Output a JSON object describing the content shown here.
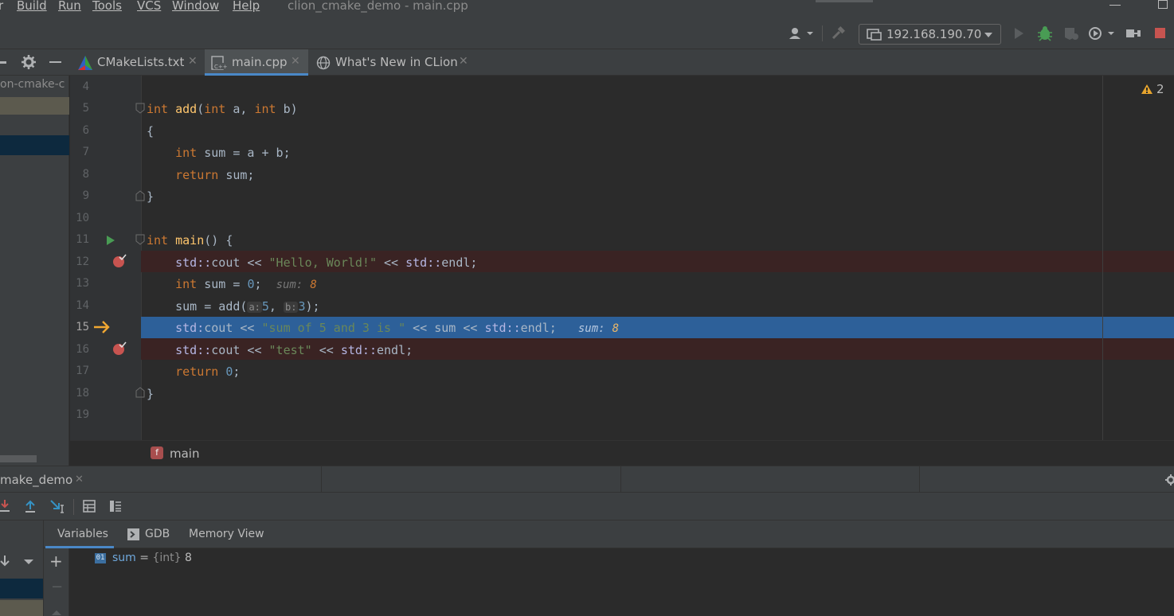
{
  "menu": {
    "items": [
      "r",
      "Build",
      "Run",
      "Tools",
      "VCS",
      "Window",
      "Help"
    ],
    "window_title": "clion_cmake_demo - main.cpp"
  },
  "toolbar": {
    "run_config": "192.168.190.70",
    "icons": [
      "user-icon",
      "build-hammer-icon",
      "remote-host-icon",
      "run-icon",
      "debug-icon",
      "coverage-icon",
      "profile-icon",
      "attach-icon",
      "stop-icon"
    ]
  },
  "tabs": [
    {
      "label": "CMakeLists.txt",
      "icon": "cmake-icon"
    },
    {
      "label": "main.cpp",
      "icon": "cpp-file-icon",
      "active": true
    },
    {
      "label": "What's New in CLion",
      "icon": "globe-icon"
    }
  ],
  "project": {
    "root_label": "on-cmake-c"
  },
  "editor": {
    "warning_count": "2",
    "lines": [
      {
        "n": "4"
      },
      {
        "n": "5",
        "tokens": [
          [
            "kw",
            "int "
          ],
          [
            "fn",
            "add"
          ],
          [
            "p",
            "("
          ],
          [
            "kw",
            "int "
          ],
          [
            "p",
            "a, "
          ],
          [
            "kw",
            "int "
          ],
          [
            "p",
            "b)"
          ]
        ]
      },
      {
        "n": "6",
        "tokens": [
          [
            "p",
            "{"
          ]
        ]
      },
      {
        "n": "7",
        "tokens": [
          [
            "p",
            "    "
          ],
          [
            "kw",
            "int "
          ],
          [
            "p",
            "sum = a + b;"
          ]
        ]
      },
      {
        "n": "8",
        "tokens": [
          [
            "p",
            "    "
          ],
          [
            "kw",
            "return "
          ],
          [
            "p",
            "sum;"
          ]
        ]
      },
      {
        "n": "9",
        "tokens": [
          [
            "p",
            "}"
          ]
        ]
      },
      {
        "n": "10"
      },
      {
        "n": "11",
        "tokens": [
          [
            "kw",
            "int "
          ],
          [
            "fn",
            "main"
          ],
          [
            "p",
            "() {"
          ]
        ]
      },
      {
        "n": "12",
        "tokens": [
          [
            "p",
            "    "
          ],
          [
            "ns",
            "std::"
          ],
          [
            "p",
            "cout << "
          ],
          [
            "str",
            "\"Hello, World!\""
          ],
          [
            "p",
            " << "
          ],
          [
            "ns",
            "std::"
          ],
          [
            "p",
            "endl;"
          ]
        ]
      },
      {
        "n": "13",
        "tokens": [
          [
            "p",
            "    "
          ],
          [
            "kw",
            "int "
          ],
          [
            "p",
            "sum = "
          ],
          [
            "num",
            "0"
          ],
          [
            "p",
            ";  "
          ]
        ]
      },
      {
        "n": "14",
        "tokens": [
          [
            "p",
            "    sum = add("
          ]
        ]
      },
      {
        "n": "15",
        "tokens": [
          [
            "p",
            "    "
          ],
          [
            "ns",
            "std:"
          ],
          [
            "p",
            "cout << "
          ],
          [
            "str",
            "\"sum of 5 and 3 is \""
          ],
          [
            "p",
            " << sum << "
          ],
          [
            "ns",
            "std::"
          ],
          [
            "p",
            "endl;"
          ]
        ]
      },
      {
        "n": "16",
        "tokens": [
          [
            "p",
            "    "
          ],
          [
            "ns",
            "std::"
          ],
          [
            "p",
            "cout << "
          ],
          [
            "str",
            "\"test\""
          ],
          [
            "p",
            " << "
          ],
          [
            "ns",
            "std::"
          ],
          [
            "p",
            "endl;"
          ]
        ]
      },
      {
        "n": "17",
        "tokens": [
          [
            "p",
            "    "
          ],
          [
            "kw",
            "return "
          ],
          [
            "num",
            "0"
          ],
          [
            "p",
            ";"
          ]
        ]
      },
      {
        "n": "18",
        "tokens": [
          [
            "p",
            "}"
          ]
        ]
      },
      {
        "n": "19"
      }
    ],
    "inline_values": {
      "line13_name": "sum:",
      "line13_value": "8",
      "line15_name": "sum:",
      "line15_value": "8"
    },
    "param_hints": {
      "a_label": "a:",
      "a_value": "5",
      "b_label": "b:",
      "b_value": "3",
      "tail": ");"
    },
    "current_line": "15",
    "breakpoint_lines": [
      "12",
      "16"
    ],
    "run_gutter_line": "11"
  },
  "breadcrumb": {
    "icon_letter": "f",
    "label": "main"
  },
  "debug": {
    "session_tab": "make_demo",
    "tabs": [
      "Variables",
      "GDB",
      "Memory View"
    ],
    "active_tab": "Variables",
    "variable": {
      "name": "sum",
      "eq": " = ",
      "type": "{int}",
      "value": "8",
      "icon_text": "01"
    }
  }
}
